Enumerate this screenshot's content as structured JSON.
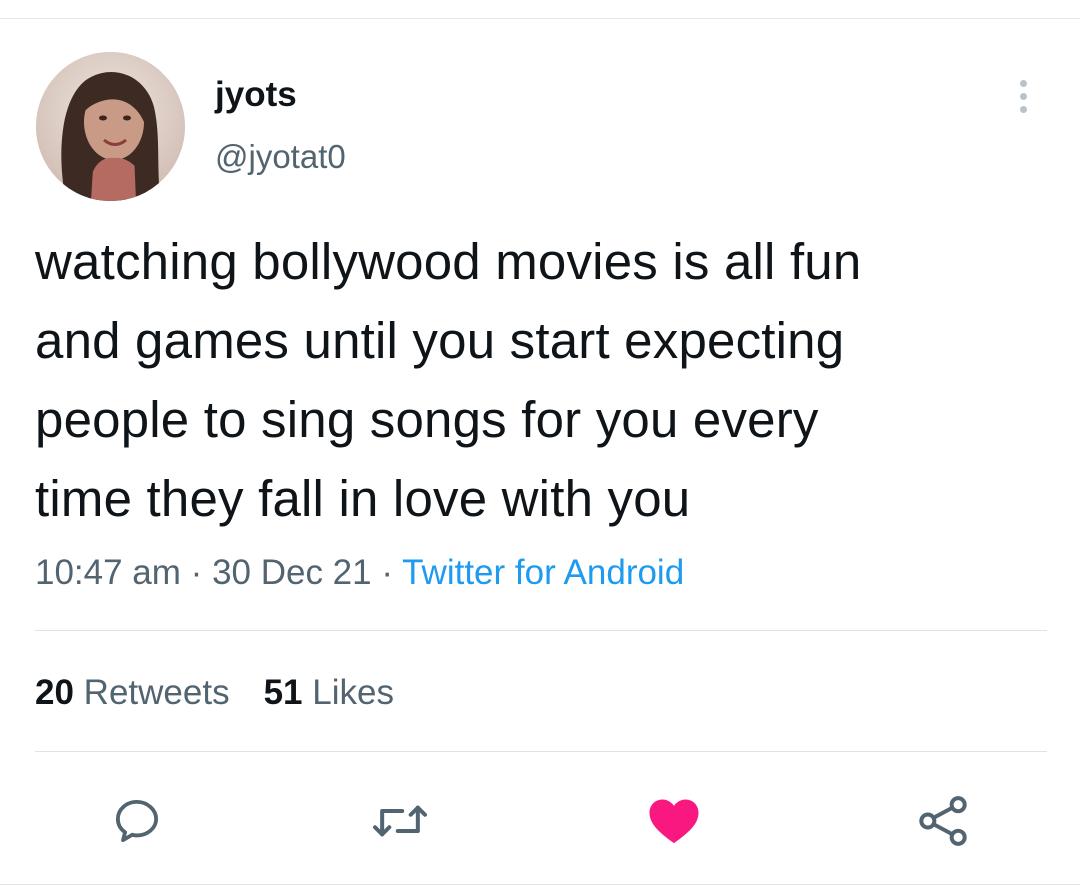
{
  "author": {
    "display_name": "jyots",
    "handle": "@jyotat0",
    "avatar_icon": "user-avatar-photo"
  },
  "tweet": {
    "text_lines": [
      "watching bollywood movies is all fun",
      "and games until you start expecting",
      "people to sing songs for you every",
      "time they fall in love with you"
    ]
  },
  "meta": {
    "time": "10:47 am",
    "separator": "·",
    "date": "30 Dec 21",
    "source": "Twitter for Android"
  },
  "stats": {
    "retweets_count": "20",
    "retweets_label": "Retweets",
    "likes_count": "51",
    "likes_label": "Likes"
  },
  "actions": {
    "reply_icon": "reply-icon",
    "retweet_icon": "retweet-icon",
    "like_icon": "heart-icon",
    "share_icon": "share-icon",
    "more_icon": "more-vertical-icon"
  },
  "colors": {
    "link": "#1d9bf0",
    "secondary_text": "#536471",
    "liked": "#f91880",
    "icon": "#536471"
  }
}
